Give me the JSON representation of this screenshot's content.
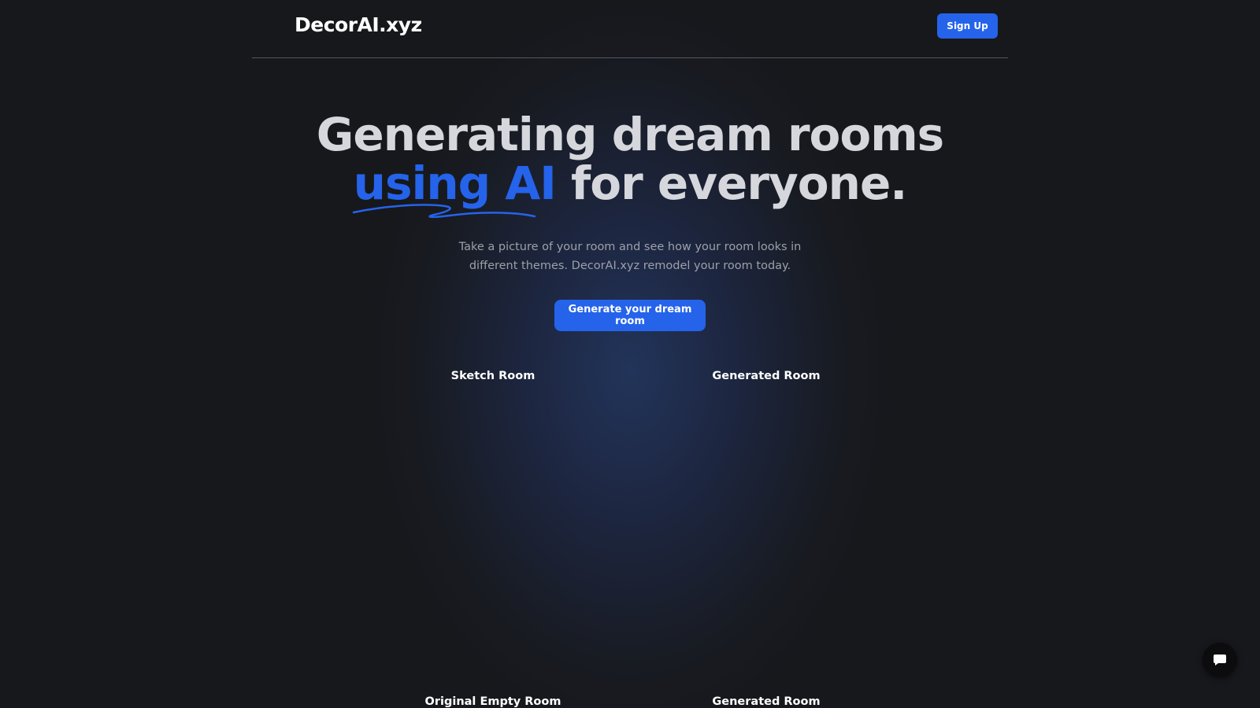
{
  "header": {
    "logo": "DecorAI.xyz",
    "signup_label": "Sign Up"
  },
  "hero": {
    "headline_line1": "Generating dream rooms",
    "headline_accent": "using AI",
    "headline_rest": " for everyone.",
    "subtitle": "Take a picture of your room and see how your room looks in different themes. DecorAI.xyz remodel your room today.",
    "cta_label": "Generate your dream room"
  },
  "showcase": {
    "row1": {
      "left_label": "Sketch Room",
      "right_label": "Generated Room"
    },
    "row2": {
      "left_label": "Original Empty Room",
      "right_label": "Generated Room"
    }
  },
  "chat_widget": {
    "icon": "chat-bubble-icon"
  },
  "colors": {
    "accent": "#2563eb",
    "background": "#17181c",
    "headline": "#d5d7dc"
  }
}
